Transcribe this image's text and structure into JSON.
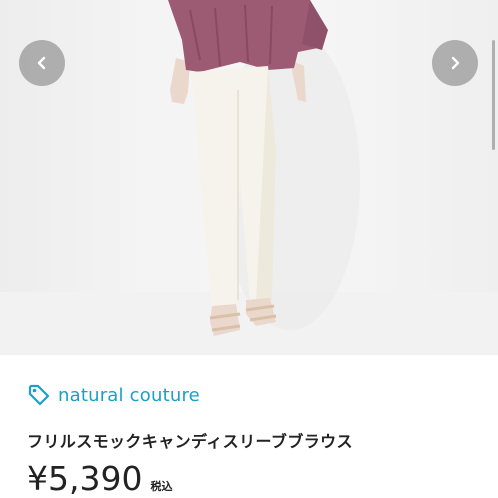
{
  "carousel": {
    "prev_icon": "chevron-left-icon",
    "next_icon": "chevron-right-icon"
  },
  "product": {
    "brand": "natural couture",
    "brand_icon": "tag-icon",
    "title": "フリルスモックキャンディスリーブブラウス",
    "price": "¥5,390",
    "tax_label": "税込"
  },
  "colors": {
    "brand_accent": "#1aa0c8",
    "text": "#222222",
    "blouse": "#9c5b73",
    "pants": "#f4f1ea"
  }
}
